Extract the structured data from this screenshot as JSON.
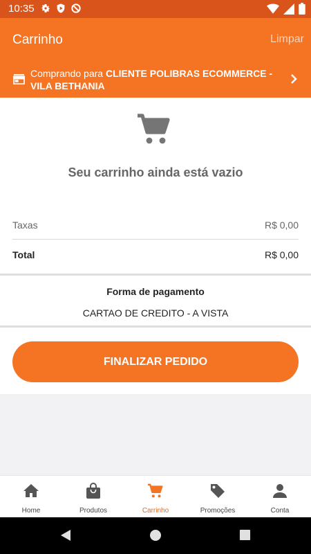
{
  "status_bar": {
    "time": "10:35"
  },
  "app_bar": {
    "title": "Carrinho",
    "clear_label": "Limpar"
  },
  "customer": {
    "prefix": "Comprando para ",
    "name": "CLIENTE POLIBRAS  ECOMMERCE - VILA BETHANIA"
  },
  "cart": {
    "empty_message": "Seu carrinho ainda está vazio"
  },
  "summary": {
    "taxes_label": "Taxas",
    "taxes_value": "R$ 0,00",
    "total_label": "Total",
    "total_value": "R$ 0,00"
  },
  "payment": {
    "title": "Forma de pagamento",
    "method": "CARTAO DE CREDITO - A VISTA"
  },
  "checkout": {
    "label": "FINALIZAR PEDIDO"
  },
  "bottom_nav": {
    "items": [
      {
        "label": "Home",
        "icon": "home-icon"
      },
      {
        "label": "Produtos",
        "icon": "bag-icon"
      },
      {
        "label": "Carrinho",
        "icon": "cart-icon",
        "active": true
      },
      {
        "label": "Promoções",
        "icon": "tag-icon"
      },
      {
        "label": "Conta",
        "icon": "person-icon"
      }
    ]
  },
  "colors": {
    "primary": "#f47424",
    "status_bar": "#d8541a",
    "muted_text": "#666666"
  }
}
